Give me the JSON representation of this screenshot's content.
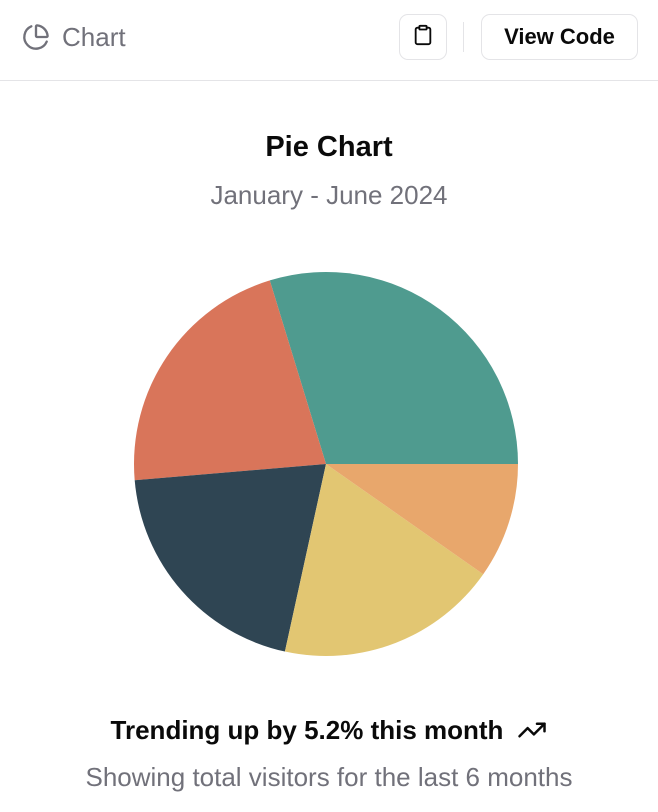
{
  "header": {
    "title": "Chart",
    "icon": "pie-chart-icon",
    "copy_icon": "clipboard-icon",
    "view_code_label": "View Code"
  },
  "card": {
    "title": "Pie Chart",
    "subtitle": "January - June 2024",
    "footer_trend": "Trending up by 5.2% this month",
    "footer_trend_icon": "trending-up-icon",
    "footer_description": "Showing total visitors for the last 6 months"
  },
  "chart_data": {
    "type": "pie",
    "title": "Pie Chart",
    "subtitle": "January - June 2024",
    "start_angle_deg": 0,
    "direction": "counterclockwise",
    "slices": [
      {
        "value": 275,
        "color": "#4f9b8f"
      },
      {
        "value": 200,
        "color": "#d9755a"
      },
      {
        "value": 187,
        "color": "#2f4553"
      },
      {
        "value": 173,
        "color": "#e2c672"
      },
      {
        "value": 90,
        "color": "#e8a76c"
      }
    ]
  }
}
